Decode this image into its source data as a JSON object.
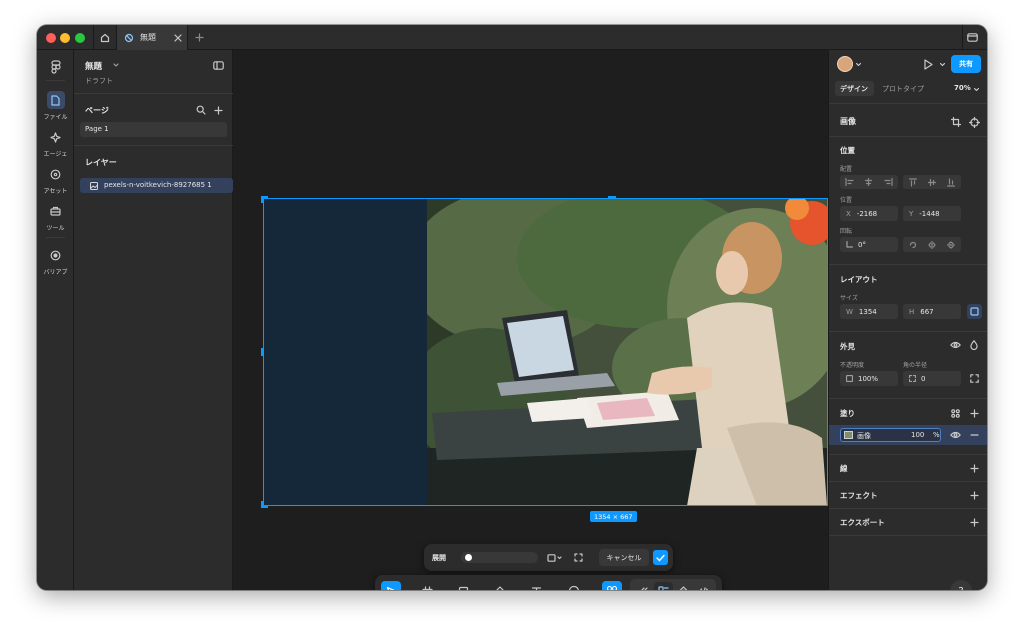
{
  "window": {
    "tabs": [
      {
        "label": "無題",
        "icon": "design-file-icon",
        "active": true
      }
    ]
  },
  "rail": {
    "items": [
      {
        "label": "ファイル",
        "icon": "file-icon",
        "active": true
      },
      {
        "label": "エージェ",
        "icon": "agent-icon"
      },
      {
        "label": "アセット",
        "icon": "assets-icon"
      },
      {
        "label": "ツール",
        "icon": "tools-icon"
      },
      {
        "label": "バリアブ",
        "icon": "variables-icon"
      }
    ]
  },
  "left_panel": {
    "file_name": "無題",
    "file_status": "ドラフト",
    "pages_header": "ページ",
    "pages": [
      "Page 1"
    ],
    "layers_header": "レイヤー",
    "layers": [
      "pexels-n-voitkevich-8927685 1"
    ]
  },
  "canvas": {
    "size_label": "1354 × 667",
    "image_bg": "#14283a",
    "selection_color": "#0d99ff",
    "crop_bar": {
      "expand_label": "展開",
      "slider_value": 0,
      "cancel_label": "キャンセル",
      "confirm_icon": "check-icon"
    },
    "tools": [
      {
        "icon": "move-arrow-icon",
        "active": true
      },
      {
        "icon": "frame-icon"
      },
      {
        "icon": "rectangle-icon"
      },
      {
        "icon": "pen-icon"
      },
      {
        "icon": "text-icon"
      },
      {
        "icon": "comment-icon"
      },
      {
        "icon": "actions-icon",
        "active": true
      }
    ],
    "modes": [
      {
        "icon": "draw-icon"
      },
      {
        "icon": "design-mode-icon",
        "active": true
      },
      {
        "icon": "components-icon"
      },
      {
        "icon": "code-icon"
      }
    ]
  },
  "right_panel": {
    "play_label": "",
    "share_label": "共有",
    "tabs": [
      "デザイン",
      "プロトタイプ"
    ],
    "zoom": "70%",
    "section_title": "画像",
    "position": {
      "title": "位置",
      "align_label": "配置",
      "pos_label": "位置",
      "x_prefix": "X",
      "x": "-2168",
      "y_prefix": "Y",
      "y": "-1448",
      "rotation_label": "回転",
      "rotation": "0°"
    },
    "layout": {
      "title": "レイアウト",
      "size_label": "サイズ",
      "w_prefix": "W",
      "w": "1354",
      "h_prefix": "H",
      "h": "667"
    },
    "appearance": {
      "title": "外見",
      "opacity_label": "不透明度",
      "opacity": "100%",
      "radius_label": "角の半径",
      "radius": "0"
    },
    "fill": {
      "title": "塗り",
      "type": "画像",
      "opacity": "100",
      "unit": "%"
    },
    "stroke_title": "線",
    "effects_title": "エフェクト",
    "export_title": "エクスポート",
    "help": "?"
  },
  "colors": {
    "accent": "#0d99ff",
    "panel": "#2c2c2c",
    "canvas": "#1e1e1e"
  }
}
